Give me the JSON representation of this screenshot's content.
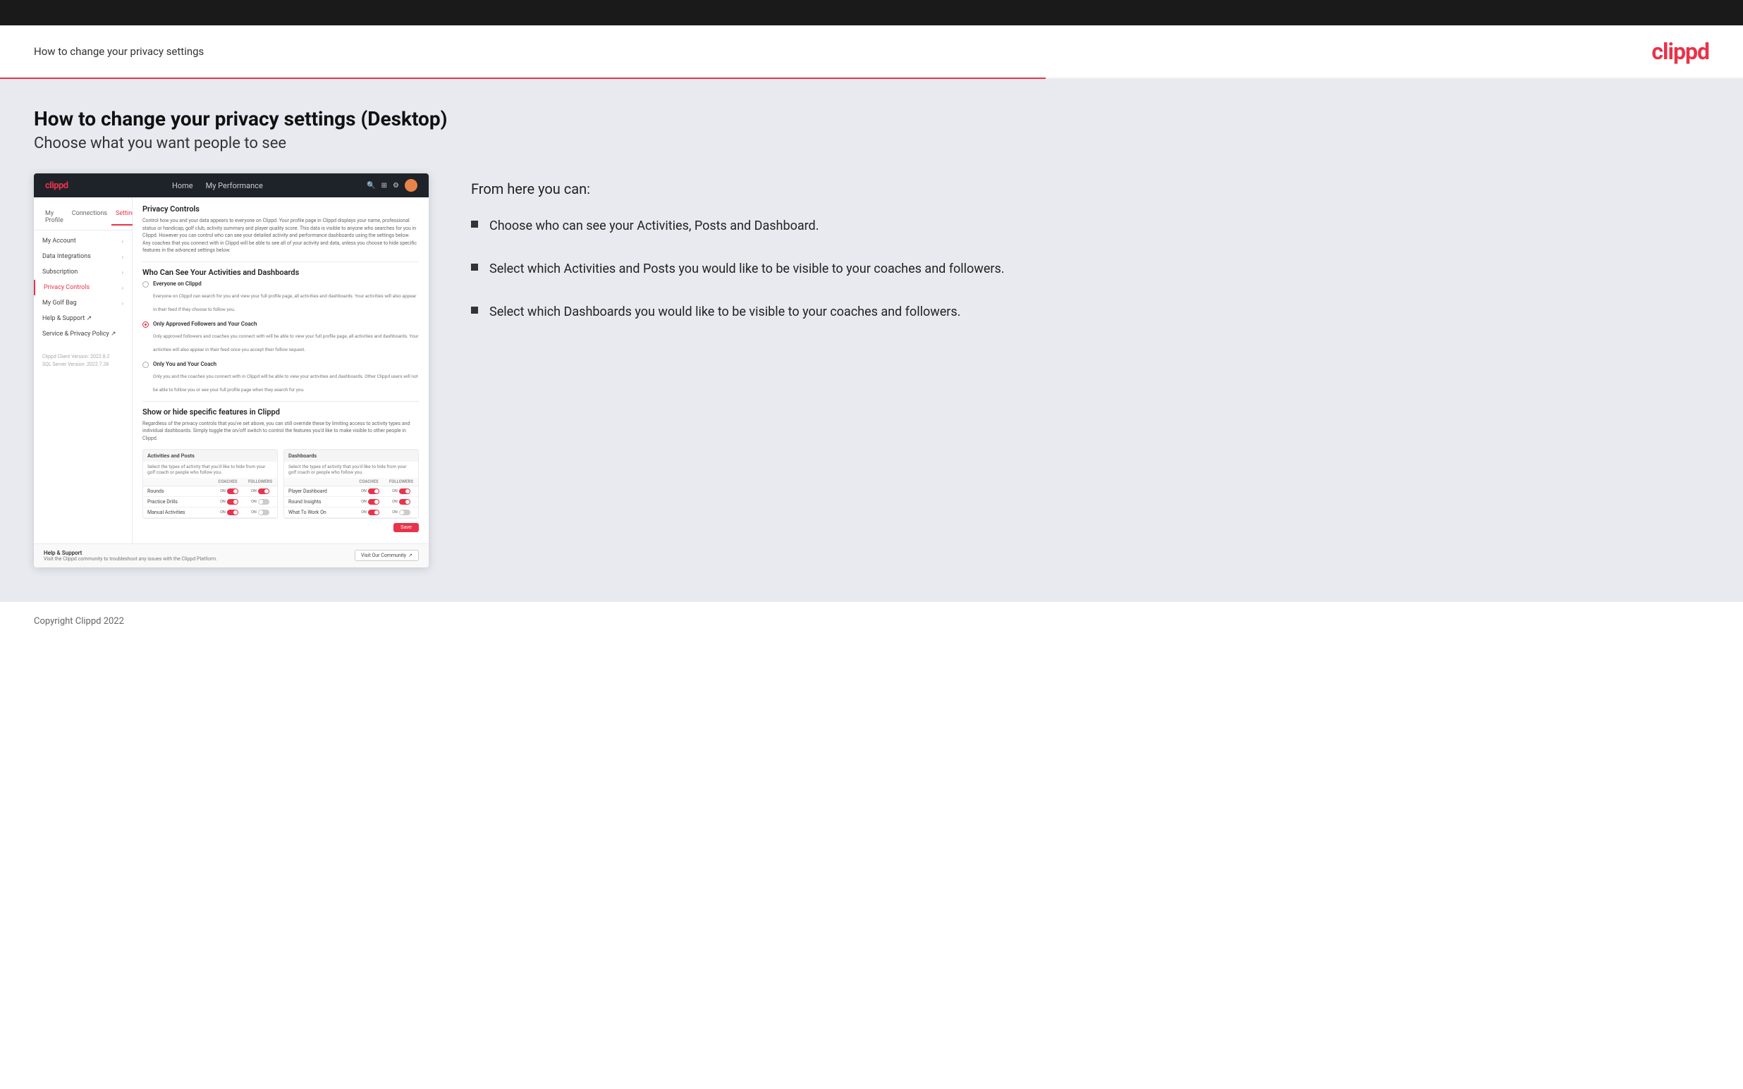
{
  "topBar": {},
  "header": {
    "title": "How to change your privacy settings",
    "logo": "clippd"
  },
  "page": {
    "heading": "How to change your privacy settings (Desktop)",
    "subheading": "Choose what you want people to see"
  },
  "mockup": {
    "nav": {
      "logo": "clippd",
      "links": [
        "Home",
        "My Performance"
      ],
      "icons": [
        "search",
        "grid",
        "settings",
        "user"
      ]
    },
    "sidebar": {
      "subNav": [
        "My Profile",
        "Connections",
        "Settings"
      ],
      "items": [
        {
          "label": "My Account",
          "active": false
        },
        {
          "label": "Data Integrations",
          "active": false
        },
        {
          "label": "Subscription",
          "active": false
        },
        {
          "label": "Privacy Controls",
          "active": true
        },
        {
          "label": "My Golf Bag",
          "active": false
        },
        {
          "label": "Help & Support",
          "active": false,
          "external": true
        },
        {
          "label": "Service & Privacy Policy",
          "active": false,
          "external": true
        }
      ],
      "version": "Clippd Client Version: 2022.8.2\nSQL Server Version: 2022.7.38"
    },
    "main": {
      "sectionTitle": "Privacy Controls",
      "sectionDesc": "Control how you and your data appears to everyone on Clippd. Your profile page in Clippd displays your name, professional status or handicap, golf club, activity summary and player quality score. This data is visible to anyone who searches for you in Clippd. However you can control who can see your detailed activity and performance dashboards using the settings below. Any coaches that you connect with in Clippd will be able to see all of your activity and data, unless you choose to hide specific features in the advanced settings below.",
      "whoCanSeeTitle": "Who Can See Your Activities and Dashboards",
      "radioOptions": [
        {
          "label": "Everyone on Clippd",
          "desc": "Everyone on Clippd can search for you and view your full profile page, all activities and dashboards. Your activities will also appear in their feed if they choose to follow you.",
          "selected": false
        },
        {
          "label": "Only Approved Followers and Your Coach",
          "desc": "Only approved followers and coaches you connect with will be able to view your full profile page, all activities and dashboards. Your activities will also appear in their feed once you accept their follow request.",
          "selected": true
        },
        {
          "label": "Only You and Your Coach",
          "desc": "Only you and the coaches you connect with in Clippd will be able to view your activities and dashboards. Other Clippd users will not be able to follow you or see your full profile page when they search for you.",
          "selected": false
        }
      ],
      "showHideTitle": "Show or hide specific features in Clippd",
      "showHideDesc": "Regardless of the privacy controls that you've set above, you can still override these by limiting access to activity types and individual dashboards. Simply toggle the on/off switch to control the features you'd like to make visible to other people in Clippd.",
      "activitiesTable": {
        "title": "Activities and Posts",
        "desc": "Select the types of activity that you'd like to hide from your golf coach or people who follow you.",
        "columns": [
          "COACHES",
          "FOLLOWERS"
        ],
        "rows": [
          {
            "label": "Rounds",
            "coachOn": true,
            "followerOn": true
          },
          {
            "label": "Practice Drills",
            "coachOn": true,
            "followerOn": true
          },
          {
            "label": "Manual Activities",
            "coachOn": true,
            "followerOn": false
          }
        ]
      },
      "dashboardsTable": {
        "title": "Dashboards",
        "desc": "Select the types of activity that you'd like to hide from your golf coach or people who follow you.",
        "columns": [
          "COACHES",
          "FOLLOWERS"
        ],
        "rows": [
          {
            "label": "Player Dashboard",
            "coachOn": true,
            "followerOn": true
          },
          {
            "label": "Round Insights",
            "coachOn": true,
            "followerOn": true
          },
          {
            "label": "What To Work On",
            "coachOn": true,
            "followerOn": false
          }
        ]
      },
      "saveLabel": "Save",
      "help": {
        "title": "Help & Support",
        "desc": "Visit the Clippd community to troubleshoot any issues with the Clippd Platform.",
        "buttonLabel": "Visit Our Community",
        "buttonIcon": "↗"
      }
    }
  },
  "rightPanel": {
    "heading": "From here you can:",
    "bullets": [
      "Choose who can see your Activities, Posts and Dashboard.",
      "Select which Activities and Posts you would like to be visible to your coaches and followers.",
      "Select which Dashboards you would like to be visible to your coaches and followers."
    ]
  },
  "footer": {
    "text": "Copyright Clippd 2022"
  }
}
